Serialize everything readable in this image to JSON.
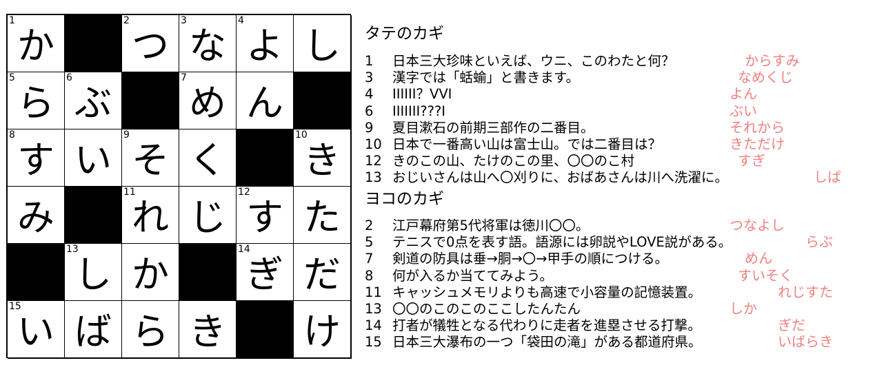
{
  "colors": {
    "answer": "#f08080",
    "block": "#000000",
    "text": "#000000"
  },
  "grid": {
    "rows": [
      [
        {
          "n": "1",
          "c": "か"
        },
        {
          "b": true
        },
        {
          "n": "2",
          "c": "つ"
        },
        {
          "n": "3",
          "c": "な"
        },
        {
          "n": "4",
          "c": "よ"
        },
        {
          "n": "",
          "c": "し"
        }
      ],
      [
        {
          "n": "5",
          "c": "ら"
        },
        {
          "n": "6",
          "c": "ぶ"
        },
        {
          "b": true
        },
        {
          "n": "7",
          "c": "め"
        },
        {
          "n": "",
          "c": "ん"
        },
        {
          "b": true
        }
      ],
      [
        {
          "n": "8",
          "c": "す"
        },
        {
          "n": "",
          "c": "い"
        },
        {
          "n": "9",
          "c": "そ"
        },
        {
          "n": "",
          "c": "く"
        },
        {
          "b": true
        },
        {
          "n": "10",
          "c": "き"
        }
      ],
      [
        {
          "n": "",
          "c": "み"
        },
        {
          "b": true
        },
        {
          "n": "11",
          "c": "れ"
        },
        {
          "n": "",
          "c": "じ"
        },
        {
          "n": "12",
          "c": "す"
        },
        {
          "n": "",
          "c": "た"
        }
      ],
      [
        {
          "b": true
        },
        {
          "n": "13",
          "c": "し"
        },
        {
          "n": "",
          "c": "か"
        },
        {
          "b": true
        },
        {
          "n": "14",
          "c": "ぎ"
        },
        {
          "n": "",
          "c": "だ"
        }
      ],
      [
        {
          "n": "15",
          "c": "い"
        },
        {
          "n": "",
          "c": "ば"
        },
        {
          "n": "",
          "c": "ら"
        },
        {
          "n": "",
          "c": "き"
        },
        {
          "b": true
        },
        {
          "n": "",
          "c": "け"
        }
      ]
    ]
  },
  "tate": {
    "title": "タテのカギ",
    "clues": [
      {
        "num": "1",
        "text": "日本三大珍味といえば、ウニ、このわたと何？",
        "answer": "からすみ"
      },
      {
        "num": "3",
        "text": "漢字では「蛞蝓」と書きます。",
        "answer": "なめくじ"
      },
      {
        "num": "4",
        "text": "IIIIII？VVI",
        "answer": "よん"
      },
      {
        "num": "6",
        "text": "IIIIIII???I",
        "answer": "ぶい"
      },
      {
        "num": "9",
        "text": "夏目漱石の前期三部作の二番目。",
        "answer": "それから"
      },
      {
        "num": "10",
        "text": "日本で一番高い山は富士山。では二番目は？",
        "answer": "きただけ"
      },
      {
        "num": "12",
        "text": "きのこの山、たけのこの里、〇〇のこ村",
        "answer": "すぎ"
      },
      {
        "num": "13",
        "text": "おじいさんは山へ〇刈りに、おばあさんは川へ洗濯に。",
        "answer": "しば"
      }
    ]
  },
  "yoko": {
    "title": "ヨコのカギ",
    "clues": [
      {
        "num": "2",
        "text": "江戸幕府第5代将軍は徳川〇〇。",
        "answer": "つなよし"
      },
      {
        "num": "5",
        "text": "テニスで0点を表す語。語源には卵説やLOVE説がある。",
        "answer": "らぶ"
      },
      {
        "num": "7",
        "text": "剣道の防具は垂→胴→〇→甲手の順につける。",
        "answer": "めん"
      },
      {
        "num": "8",
        "text": "何が入るか当ててみよう。",
        "answer": "すいそく"
      },
      {
        "num": "11",
        "text": "キャッシュメモリよりも高速で小容量の記憶装置。",
        "answer": "れじすた"
      },
      {
        "num": "13",
        "text": "〇〇のこのこのここしたんたん",
        "answer": "しか"
      },
      {
        "num": "14",
        "text": "打者が犠牲となる代わりに走者を進塁させる打撃。",
        "answer": "ぎだ"
      },
      {
        "num": "15",
        "text": "日本三大瀑布の一つ「袋田の滝」がある都道府県。",
        "answer": "いばらき"
      }
    ]
  }
}
